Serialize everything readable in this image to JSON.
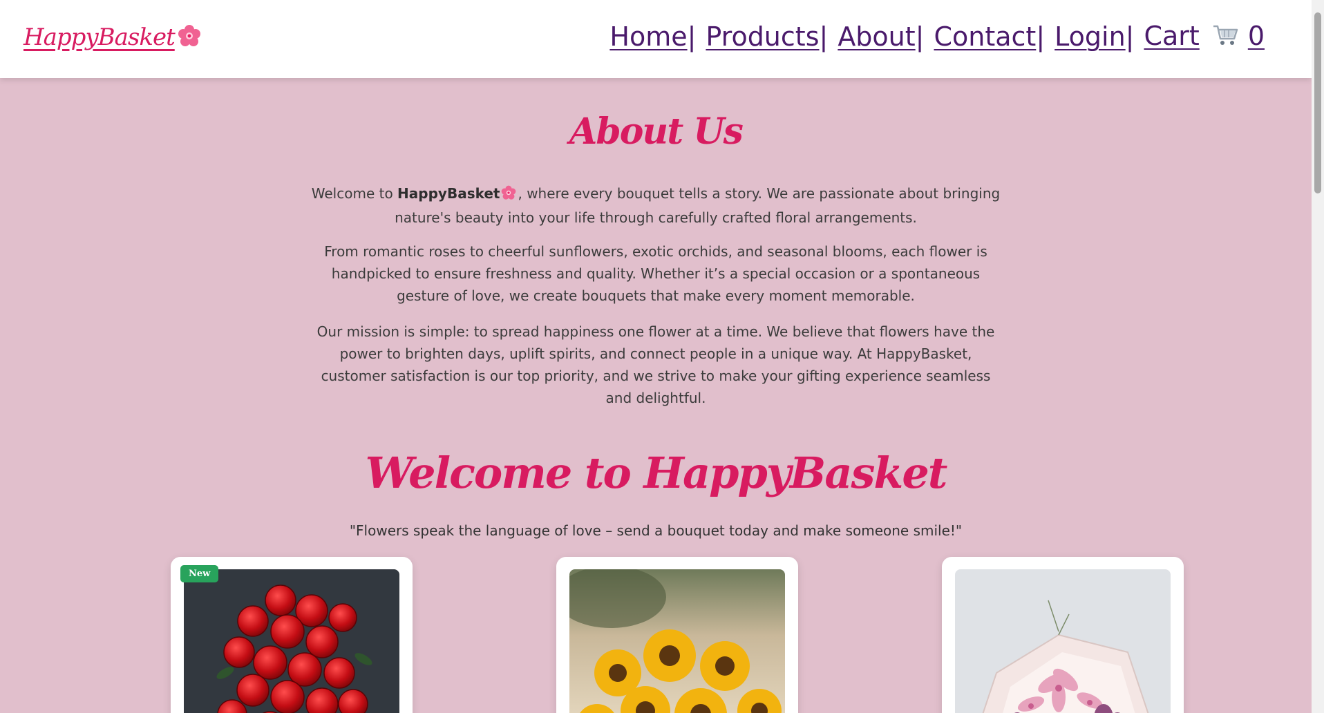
{
  "header": {
    "logo_text": "HappyBasket",
    "nav": [
      {
        "label": "Home"
      },
      {
        "label": "Products"
      },
      {
        "label": "About"
      },
      {
        "label": "Contact"
      },
      {
        "label": "Login"
      }
    ],
    "separator": "|",
    "cart_label": "Cart",
    "cart_count": "0"
  },
  "about": {
    "title": "About Us",
    "p1_before": "Welcome to ",
    "p1_brand": "HappyBasket",
    "p1_after": ", where every bouquet tells a story. We are passionate about bringing nature's beauty into your life through carefully crafted floral arrangements.",
    "p2": "From romantic roses to cheerful sunflowers, exotic orchids, and seasonal blooms, each flower is handpicked to ensure freshness and quality. Whether it’s a special occasion or a spontaneous gesture of love, we create bouquets that make every moment memorable.",
    "p3": "Our mission is simple: to spread happiness one flower at a time. We believe that flowers have the power to brighten days, uplift spirits, and connect people in a unique way. At HappyBasket, customer satisfaction is our top priority, and we strive to make your gifting experience seamless and delightful."
  },
  "welcome": {
    "title": "Welcome to HappyBasket",
    "quote": "\"Flowers speak the language of love – send a bouquet today and make someone smile!\""
  },
  "products": [
    {
      "badge": "New",
      "image": "red-roses-bouquet"
    },
    {
      "image": "sunflowers-bouquet"
    },
    {
      "image": "pink-lilies-bouquet"
    }
  ],
  "colors": {
    "page_bg": "#e1bfcc",
    "accent": "#d81b60",
    "nav_link": "#4a1a6b",
    "badge": "#28a35c"
  }
}
